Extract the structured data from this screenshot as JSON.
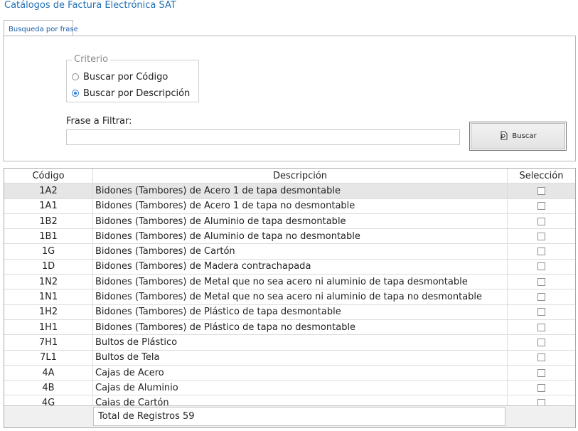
{
  "window": {
    "title": "Catálogos de Factura Electrónica SAT"
  },
  "tabs": [
    {
      "label": "Busqueda por frase",
      "active": true
    }
  ],
  "criteria": {
    "legend": "Criterio",
    "options": [
      {
        "label": "Buscar por Código",
        "selected": false
      },
      {
        "label": "Buscar por Descripción",
        "selected": true
      }
    ]
  },
  "filter": {
    "label": "Frase a Filtrar:",
    "value": "",
    "button_label": "Buscar",
    "button_icon": "search-doc-icon"
  },
  "table": {
    "columns": [
      "Código",
      "Descripción",
      "Selección"
    ],
    "rows": [
      {
        "code": "1A2",
        "desc": "Bidones (Tambores) de Acero 1 de tapa desmontable",
        "checked": false
      },
      {
        "code": "1A1",
        "desc": "Bidones (Tambores) de Acero 1 de tapa no desmontable",
        "checked": false
      },
      {
        "code": "1B2",
        "desc": "Bidones (Tambores) de Aluminio de tapa desmontable",
        "checked": false
      },
      {
        "code": "1B1",
        "desc": "Bidones (Tambores) de Aluminio de tapa no desmontable",
        "checked": false
      },
      {
        "code": "1G",
        "desc": "Bidones (Tambores) de Cartón",
        "checked": false
      },
      {
        "code": "1D",
        "desc": "Bidones (Tambores) de Madera contrachapada",
        "checked": false
      },
      {
        "code": "1N2",
        "desc": "Bidones (Tambores) de Metal que no sea acero ni aluminio de tapa desmontable",
        "checked": false
      },
      {
        "code": "1N1",
        "desc": "Bidones (Tambores) de Metal que no sea acero ni aluminio de tapa no desmontable",
        "checked": false
      },
      {
        "code": "1H2",
        "desc": "Bidones (Tambores) de Plástico de tapa desmontable",
        "checked": false
      },
      {
        "code": "1H1",
        "desc": "Bidones (Tambores) de Plástico de tapa no desmontable",
        "checked": false
      },
      {
        "code": "7H1",
        "desc": "Bultos de Plástico",
        "checked": false
      },
      {
        "code": "7L1",
        "desc": "Bultos de Tela",
        "checked": false
      },
      {
        "code": "4A",
        "desc": "Cajas de Acero",
        "checked": false
      },
      {
        "code": "4B",
        "desc": "Cajas de Aluminio",
        "checked": false
      },
      {
        "code": "4G",
        "desc": "Cajas de Cartón",
        "checked": false
      }
    ],
    "selected_row_index": 0
  },
  "footer": {
    "total_text": "Total de Registros 59"
  },
  "colors": {
    "title": "#1f6fb5",
    "selected_row": "#e6e6e6",
    "radio_accent": "#2b7bd3"
  }
}
